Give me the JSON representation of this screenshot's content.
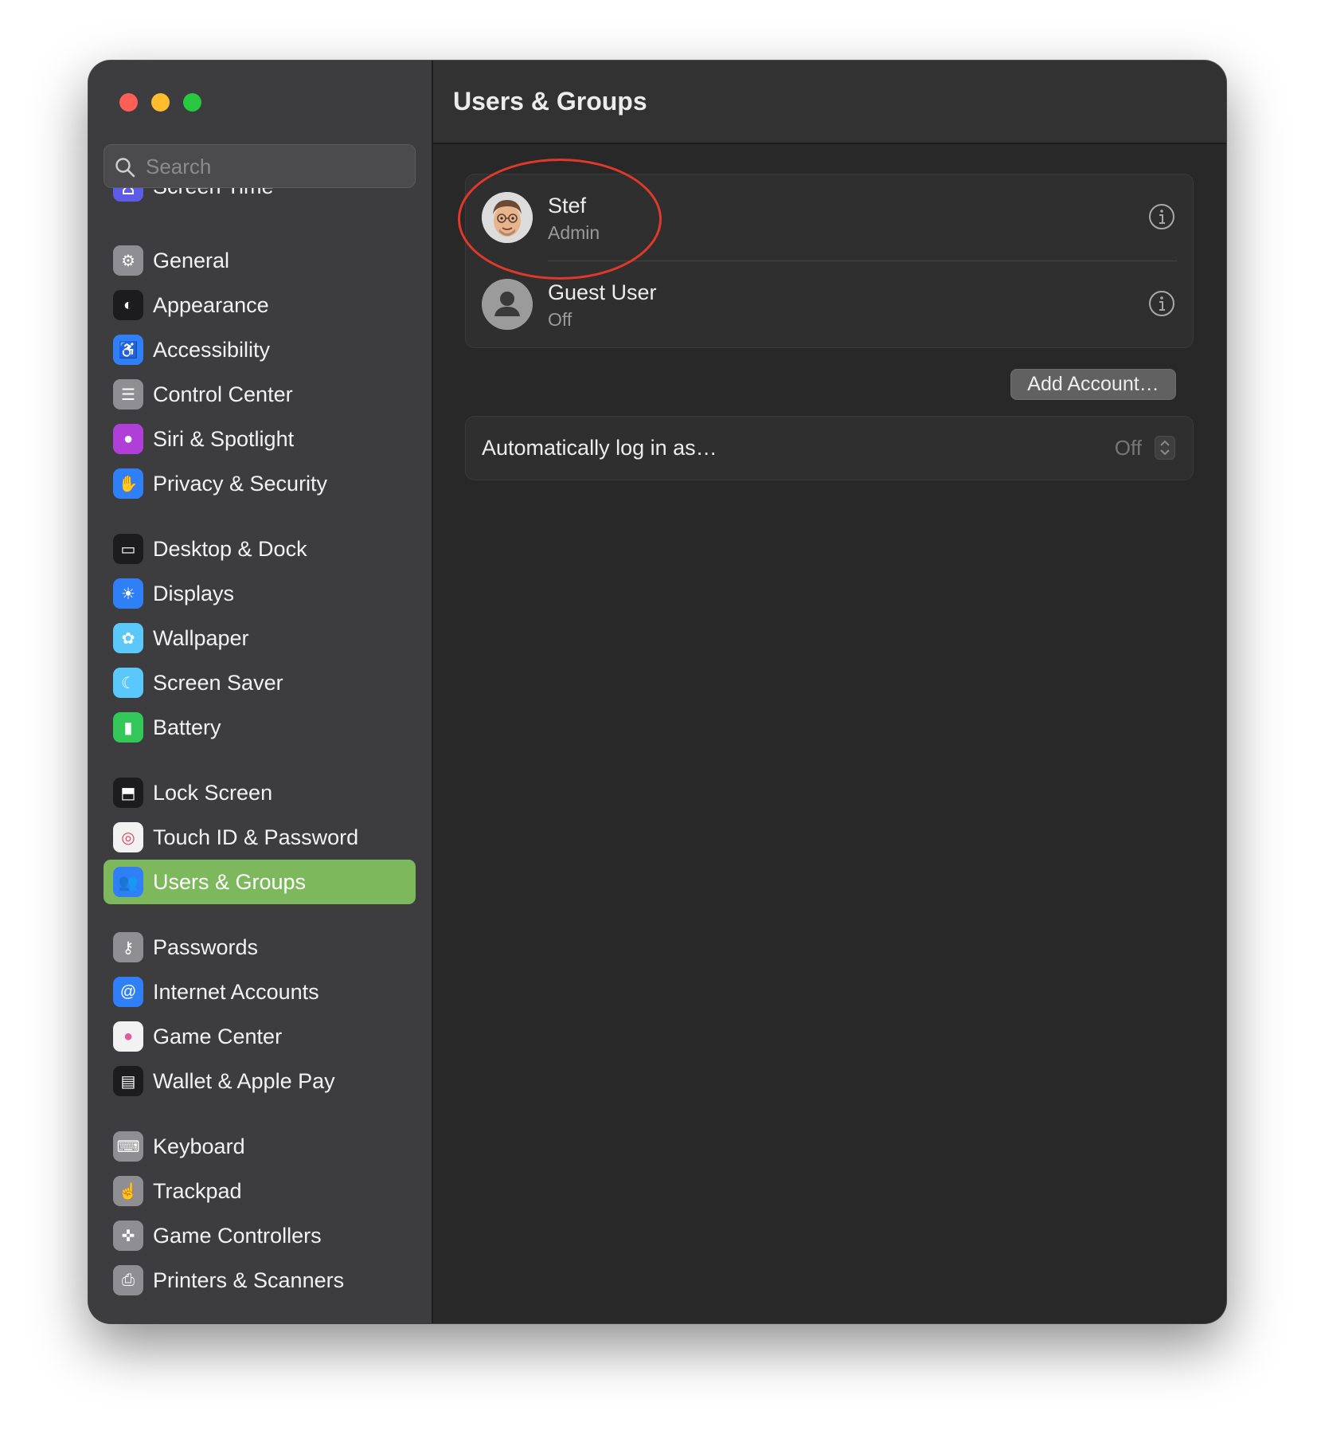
{
  "window": {
    "traffic_lights": [
      "close",
      "minimize",
      "zoom"
    ]
  },
  "sidebar": {
    "search_placeholder": "Search",
    "partial_item": {
      "label": "Screen Time",
      "icon": "hourglass-icon",
      "color": "#5e5ce6"
    },
    "items": [
      {
        "label": "General",
        "icon": "gear-icon",
        "color": "#8e8e93"
      },
      {
        "label": "Appearance",
        "icon": "appearance-icon",
        "color": "#1c1c1e"
      },
      {
        "label": "Accessibility",
        "icon": "accessibility-icon",
        "color": "#2f7ff6"
      },
      {
        "label": "Control Center",
        "icon": "control-center-icon",
        "color": "#8e8e93"
      },
      {
        "label": "Siri & Spotlight",
        "icon": "siri-icon",
        "color": "#b03fd8"
      },
      {
        "label": "Privacy & Security",
        "icon": "hand-icon",
        "color": "#2f7ff6"
      },
      {
        "label": "Desktop & Dock",
        "icon": "dock-icon",
        "color": "#1c1c1e"
      },
      {
        "label": "Displays",
        "icon": "sun-icon",
        "color": "#2f7ff6"
      },
      {
        "label": "Wallpaper",
        "icon": "flower-icon",
        "color": "#5ac8fa"
      },
      {
        "label": "Screen Saver",
        "icon": "moon-icon",
        "color": "#5ac8fa"
      },
      {
        "label": "Battery",
        "icon": "battery-icon",
        "color": "#34c759"
      },
      {
        "label": "Lock Screen",
        "icon": "lock-screen-icon",
        "color": "#1c1c1e"
      },
      {
        "label": "Touch ID & Password",
        "icon": "fingerprint-icon",
        "color": "#f2f2f2"
      },
      {
        "label": "Users & Groups",
        "icon": "users-icon",
        "color": "#2f7ff6",
        "active": true
      },
      {
        "label": "Passwords",
        "icon": "key-icon",
        "color": "#8e8e93"
      },
      {
        "label": "Internet Accounts",
        "icon": "at-icon",
        "color": "#2f7ff6"
      },
      {
        "label": "Game Center",
        "icon": "game-center-icon",
        "color": "#f2f2f2"
      },
      {
        "label": "Wallet & Apple Pay",
        "icon": "wallet-icon",
        "color": "#1c1c1e"
      },
      {
        "label": "Keyboard",
        "icon": "keyboard-icon",
        "color": "#8e8e93"
      },
      {
        "label": "Trackpad",
        "icon": "trackpad-icon",
        "color": "#8e8e93"
      },
      {
        "label": "Game Controllers",
        "icon": "gamepad-icon",
        "color": "#8e8e93"
      },
      {
        "label": "Printers & Scanners",
        "icon": "printer-icon",
        "color": "#8e8e93"
      }
    ]
  },
  "main": {
    "title": "Users & Groups",
    "users": [
      {
        "name": "Stef",
        "role": "Admin",
        "avatar": "memoji-avatar"
      },
      {
        "name": "Guest User",
        "role": "Off",
        "avatar": "person-silhouette-avatar"
      }
    ],
    "add_account_label": "Add Account…",
    "auto_login": {
      "label": "Automatically log in as…",
      "value": "Off"
    }
  },
  "colors": {
    "selection": "#7db85d",
    "annotation_circle": "#e0392c"
  }
}
